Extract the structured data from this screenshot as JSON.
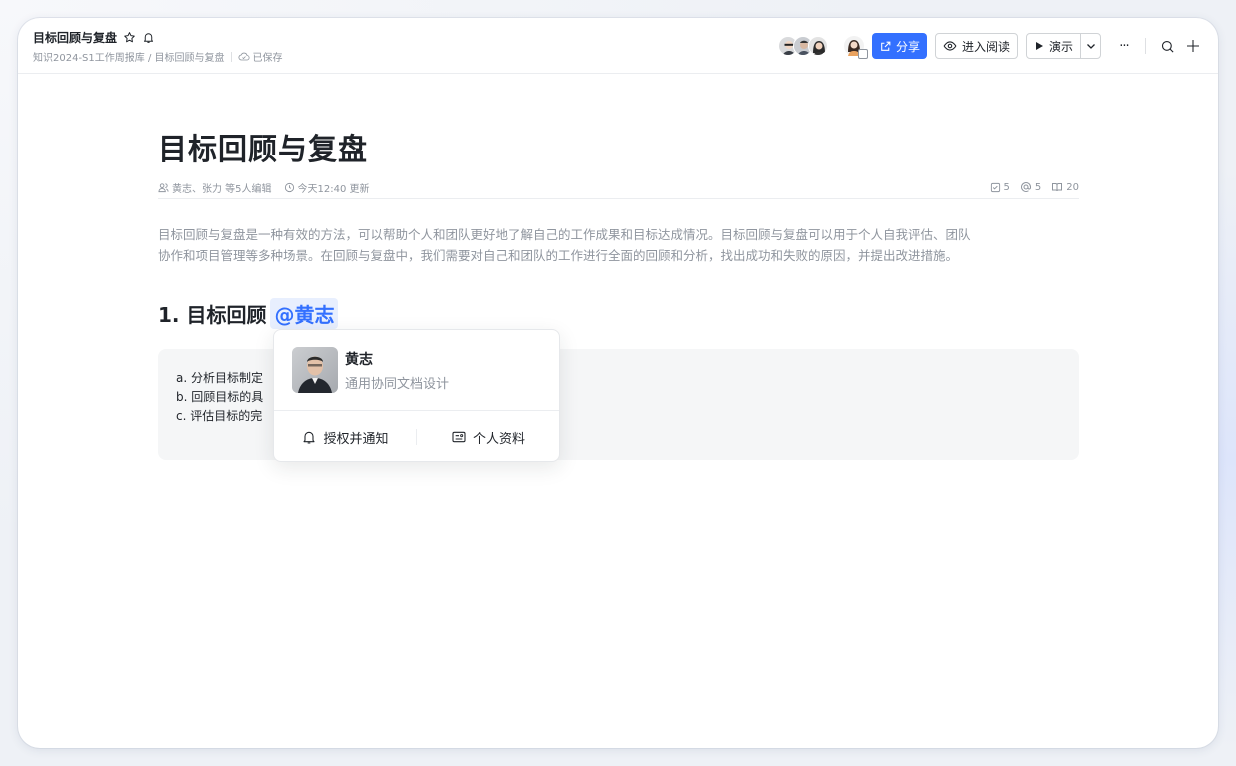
{
  "header": {
    "doc_title": "目标回顾与复盘",
    "breadcrumb": "知识2024-S1工作周报库 / 目标回顾与复盘",
    "saved_label": "已保存",
    "share_label": "分享",
    "read_label": "进入阅读",
    "present_label": "演示",
    "more_label": "···"
  },
  "document": {
    "title": "目标回顾与复盘",
    "meta_editors": "黄志、张力 等5人编辑",
    "meta_updated": "今天12:40 更新",
    "stat_tasks": "5",
    "stat_mentions": "5",
    "stat_reads": "20",
    "intro_line1": "目标回顾与复盘是一种有效的方法，可以帮助个人和团队更好地了解自己的工作成果和目标达成情况。目标回顾与复盘可以用于个人自我评估、团队",
    "intro_line2": "协作和项目管理等多种场景。在回顾与复盘中，我们需要对自己和团队的工作进行全面的回顾和分析，找出成功和失败的原因，并提出改进措施。",
    "heading1": "1. 目标回顾",
    "mention": "@黄志",
    "callout_items": [
      "a. 分析目标制定",
      "b. 回顾目标的具",
      "c. 评估目标的完"
    ]
  },
  "popup": {
    "name": "黄志",
    "desc": "通用协同文档设计",
    "action_notify": "授权并通知",
    "action_profile": "个人资料"
  },
  "colors": {
    "accent": "#3370ff",
    "mention_bg": "#e8effe",
    "callout_bg": "#f5f6f7"
  }
}
